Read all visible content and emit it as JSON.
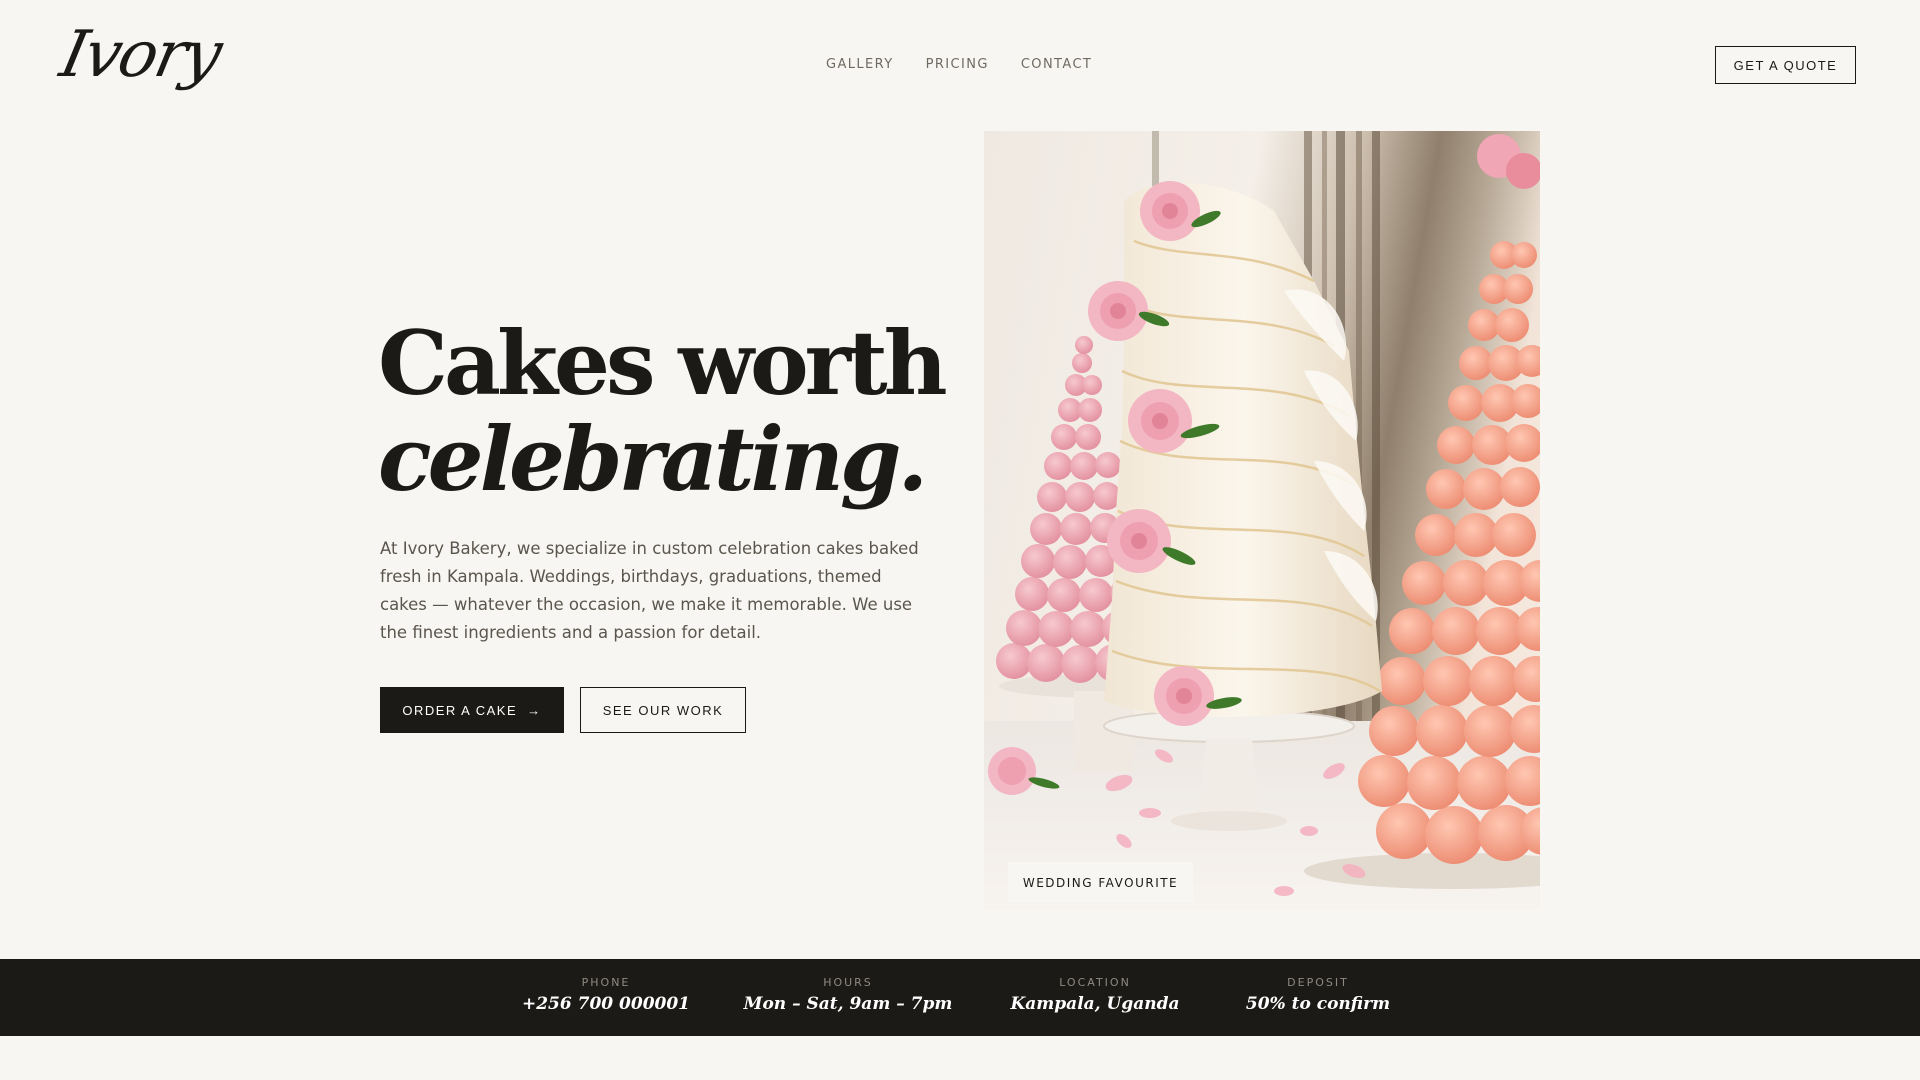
{
  "header": {
    "logo": "Ivory",
    "nav": [
      "GALLERY",
      "PRICING",
      "CONTACT"
    ],
    "cta": "GET A QUOTE"
  },
  "hero": {
    "title_line1": "Cakes worth",
    "title_line2": "celebrating.",
    "description": "At Ivory Bakery, we specialize in custom celebration cakes baked fresh in Kampala. Weddings, birthdays, graduations, themed cakes — whatever the occasion, we make it memorable. We use the finest ingredients and a passion for detail.",
    "primary_button": "ORDER A CAKE",
    "primary_arrow": "→",
    "secondary_button": "SEE OUR WORK",
    "image_tag": "WEDDING FAVOURITE"
  },
  "info_bar": {
    "phone": {
      "label": "PHONE",
      "value": "+256 700 000001"
    },
    "hours": {
      "label": "HOURS",
      "value": "Mon – Sat, 9am – 7pm"
    },
    "location": {
      "label": "LOCATION",
      "value": "Kampala, Uganda"
    },
    "deposit": {
      "label": "DEPOSIT",
      "value": "50% to confirm"
    }
  },
  "colors": {
    "background": "#f8f6f2",
    "ink": "#1c1a16",
    "muted": "#5a554d",
    "macaron_pink": "#e9a3ae",
    "macaron_peach": "#f09e86",
    "rose": "#f1b6c2",
    "leaf": "#3f7a2a"
  }
}
